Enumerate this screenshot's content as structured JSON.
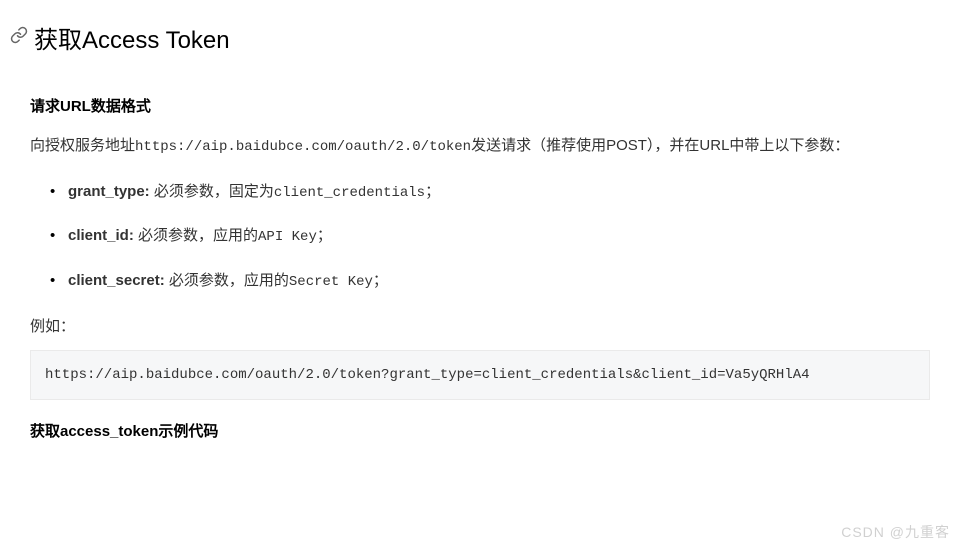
{
  "header": {
    "title": "获取Access Token",
    "link_icon": "link-icon"
  },
  "section1": {
    "heading": "请求URL数据格式",
    "intro_prefix": "向授权服务地址",
    "intro_url": "https://aip.baidubce.com/oauth/2.0/token",
    "intro_suffix": "发送请求（推荐使用POST），并在URL中带上以下参数：",
    "params": [
      {
        "name": "grant_type:",
        "desc_prefix": " 必须参数，固定为",
        "code": "client_credentials",
        "desc_suffix": "；"
      },
      {
        "name": "client_id:",
        "desc_prefix": " 必须参数，应用的",
        "code": "API Key",
        "desc_suffix": "；"
      },
      {
        "name": "client_secret:",
        "desc_prefix": " 必须参数，应用的",
        "code": "Secret Key",
        "desc_suffix": "；"
      }
    ],
    "example_label": "例如：",
    "example_code": "https://aip.baidubce.com/oauth/2.0/token?grant_type=client_credentials&client_id=Va5yQRHlA4"
  },
  "section2": {
    "heading": "获取access_token示例代码"
  },
  "watermark": "CSDN @九重客"
}
